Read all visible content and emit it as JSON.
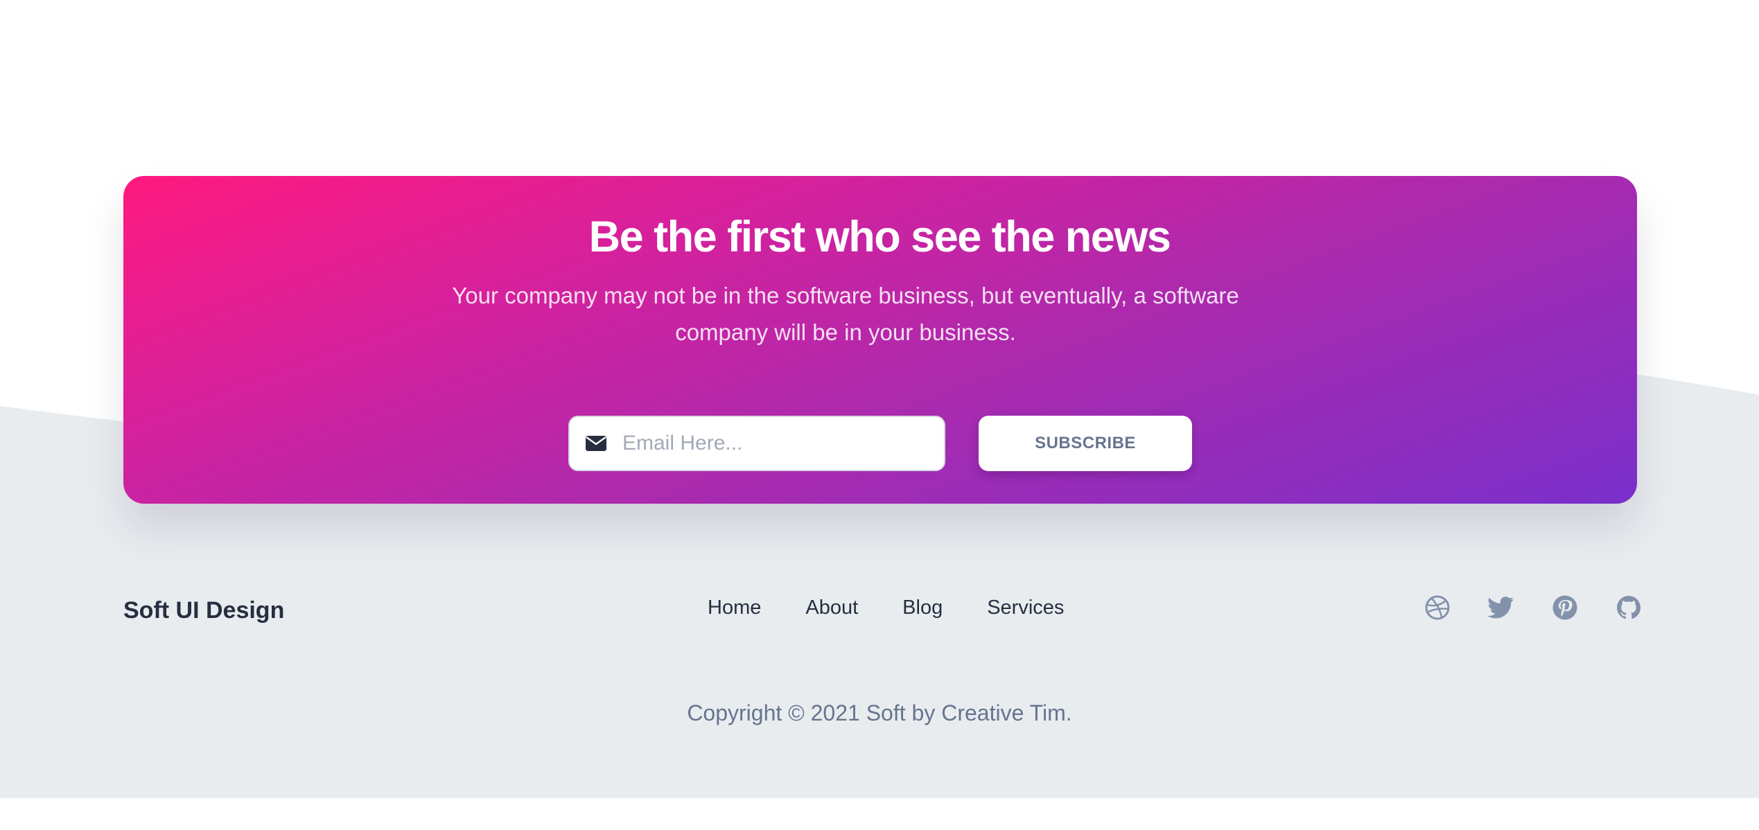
{
  "newsletter": {
    "title": "Be the first who see the news",
    "subtitle": "Your company may not be in the software business, but eventually, a software company will be in your business.",
    "email_placeholder": "Email Here...",
    "subscribe_label": "SUBSCRIBE",
    "gradient_start": "#ff1a7f",
    "gradient_end": "#7a2fcb"
  },
  "footer": {
    "brand": "Soft UI Design",
    "nav": [
      {
        "label": "Home"
      },
      {
        "label": "About"
      },
      {
        "label": "Blog"
      },
      {
        "label": "Services"
      }
    ],
    "socials": [
      "dribbble-icon",
      "twitter-icon",
      "pinterest-icon",
      "github-icon"
    ],
    "copyright": "Copyright © 2021 Soft by Creative Tim.",
    "background_color": "#e9ecef"
  }
}
